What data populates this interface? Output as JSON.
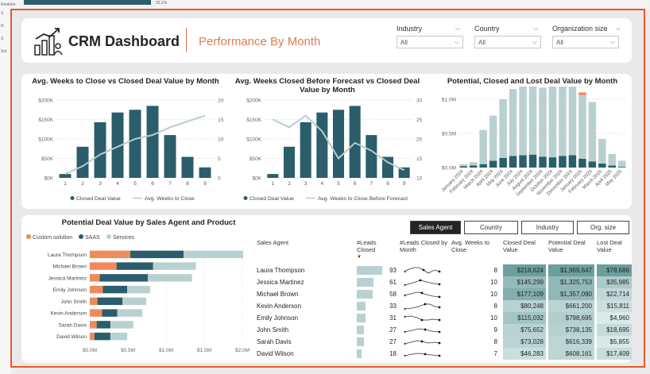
{
  "app": {
    "title": "CRM Dashboard",
    "subtitle": "Performance By Month"
  },
  "background": {
    "left_labels": [
      "Relation",
      "S",
      "N",
      "S",
      "Sot"
    ],
    "top_value": "32.1%"
  },
  "filters": [
    {
      "label": "Industry",
      "value": "All"
    },
    {
      "label": "Country",
      "value": "All"
    },
    {
      "label": "Organization size",
      "value": "All"
    }
  ],
  "colors": {
    "teal": "#2b5e6a",
    "light": "#b8d1d0",
    "orange": "#f08a5d",
    "line": "#b8cccc",
    "accent": "#e8582c"
  },
  "chart1": {
    "title": "Avg. Weeks to Close vs Closed Deal Value by Month",
    "legend": [
      "Closed Deal Value",
      "Avg. Weeks to Close"
    ]
  },
  "chart2": {
    "title_line1": "Avg. Weeks Closed Before Forecast vs Closed Deal",
    "title_line2": "Value by Month",
    "legend": [
      "Closed Deal Value",
      "Avg. Weeks to Close Before Forecast"
    ]
  },
  "chart3": {
    "title": "Potential, Closed and Lost Deal Value by Month"
  },
  "chart4": {
    "title": "Potential Deal Value by Sales Agent and Product",
    "legend": [
      "Custom solution",
      "SAAS",
      "Services"
    ]
  },
  "chart_data": [
    {
      "type": "bar",
      "title": "Avg. Weeks to Close vs Closed Deal Value by Month",
      "categories": [
        "1",
        "2",
        "3",
        "4",
        "5",
        "6",
        "7",
        "8",
        "9"
      ],
      "series": [
        {
          "name": "Closed Deal Value",
          "values": [
            10000,
            80000,
            143000,
            168000,
            175000,
            185000,
            110000,
            54000,
            27000
          ]
        },
        {
          "name": "Avg. Weeks to Close",
          "values": [
            1,
            3,
            6,
            8,
            10,
            11,
            13,
            14.5,
            16
          ]
        }
      ],
      "y_ticks": [
        "$0K",
        "$50K",
        "$100K",
        "$150K",
        "$200K"
      ],
      "y2_ticks": [
        "0",
        "5",
        "10",
        "15",
        "20"
      ],
      "ylim": [
        0,
        200000
      ],
      "y2lim": [
        0,
        20
      ]
    },
    {
      "type": "bar",
      "title": "Avg. Weeks Closed Before Forecast vs Closed Deal Value by Month",
      "categories": [
        "1",
        "2",
        "3",
        "4",
        "5",
        "6",
        "7",
        "8",
        "9"
      ],
      "series": [
        {
          "name": "Closed Deal Value",
          "values": [
            10000,
            80000,
            143000,
            168000,
            175000,
            185000,
            110000,
            54000,
            27000
          ]
        },
        {
          "name": "Avg. Weeks to Close Before Forecast",
          "values": [
            25,
            23,
            26,
            22,
            15,
            19,
            17,
            14,
            12
          ]
        }
      ],
      "y_ticks": [
        "$0K",
        "$50K",
        "$100K",
        "$150K",
        "$200K"
      ],
      "y2_ticks": [
        "10",
        "15",
        "20",
        "25",
        "30"
      ],
      "ylim": [
        0,
        200000
      ],
      "y2lim": [
        10,
        30
      ]
    },
    {
      "type": "bar",
      "title": "Potential, Closed and Lost Deal Value by Month",
      "categories": [
        "January 2024",
        "February 2024",
        "March 2024",
        "April 2024",
        "May 2024",
        "June 2024",
        "July 2024",
        "August 2024",
        "September 2024",
        "October 2024",
        "November 2024",
        "December 2024",
        "January 2025",
        "February 2025",
        "March 2025",
        "April 2025",
        "May 2025"
      ],
      "series": [
        {
          "name": "Closed",
          "values": [
            0.02,
            0.03,
            0.05,
            0.1,
            0.14,
            0.17,
            0.18,
            0.19,
            0.16,
            0.15,
            0.17,
            0.18,
            0.13,
            0.09,
            0.06,
            0.03,
            0.01
          ]
        },
        {
          "name": "Potential",
          "values": [
            0.03,
            0.05,
            0.5,
            0.66,
            0.86,
            0.98,
            1.08,
            1.15,
            1.01,
            1.05,
            1.18,
            1.09,
            0.93,
            0.87,
            0.36,
            0.17,
            0.09
          ]
        },
        {
          "name": "Lost",
          "values": [
            0,
            0,
            0,
            0,
            0,
            0,
            0,
            0.05,
            0,
            0,
            0.05,
            0.02,
            0.04,
            0,
            0,
            0,
            0
          ]
        }
      ],
      "y_ticks": [
        "$0.0M",
        "$0.5M",
        "$1.0M"
      ],
      "ylim": [
        0,
        1.0
      ]
    },
    {
      "type": "bar",
      "title": "Potential Deal Value by Sales Agent and Product",
      "orientation": "horizontal",
      "categories": [
        "Laura Thompson",
        "Michael Brown",
        "Jessica Martinez",
        "Emily Johnson",
        "John Smith",
        "Kevin Anderson",
        "Sarah Davis",
        "David Wilson"
      ],
      "series": [
        {
          "name": "Custom solution",
          "values": [
            0.53,
            0.35,
            0.13,
            0.17,
            0.1,
            0.16,
            0.09,
            0.06
          ]
        },
        {
          "name": "SAAS",
          "values": [
            0.7,
            0.48,
            0.63,
            0.32,
            0.33,
            0.2,
            0.18,
            0.21
          ]
        },
        {
          "name": "Services",
          "values": [
            0.78,
            0.56,
            0.58,
            0.3,
            0.31,
            0.33,
            0.3,
            0.22
          ]
        }
      ],
      "x_ticks": [
        "$0.0M",
        "$0.5M",
        "$1.0M",
        "$1.5M",
        "$2.0M"
      ],
      "xlim": [
        0,
        2.0
      ]
    }
  ],
  "tabs": [
    "Sales Agent",
    "Country",
    "Industry",
    "Org. size"
  ],
  "table": {
    "headers": [
      "Sales Agent",
      "#Leads Closed",
      "#Leads Closed by Month",
      "Avg. Weeks to Close",
      "Closed Deal Value",
      "Potential Deal Value",
      "Lost Deal Value"
    ],
    "rows": [
      {
        "agent": "Laura Thompson",
        "leads": "93",
        "leads_n": 93,
        "weeks": "8",
        "closed": "$218,624",
        "closed_n": 218624,
        "potential": "$1,969,647",
        "potential_n": 1969647,
        "lost": "$78,686",
        "lost_n": 78686
      },
      {
        "agent": "Jessica Martinez",
        "leads": "61",
        "leads_n": 61,
        "weeks": "10",
        "closed": "$145,299",
        "closed_n": 145299,
        "potential": "$1,325,753",
        "potential_n": 1325753,
        "lost": "$35,985",
        "lost_n": 35985
      },
      {
        "agent": "Michael Brown",
        "leads": "58",
        "leads_n": 58,
        "weeks": "10",
        "closed": "$177,109",
        "closed_n": 177109,
        "potential": "$1,357,090",
        "potential_n": 1357090,
        "lost": "$22,714",
        "lost_n": 22714
      },
      {
        "agent": "Kevin Anderson",
        "leads": "33",
        "leads_n": 33,
        "weeks": "8",
        "closed": "$80,248",
        "closed_n": 80248,
        "potential": "$661,200",
        "potential_n": 661200,
        "lost": "$15,811",
        "lost_n": 15811
      },
      {
        "agent": "Emily Johnson",
        "leads": "31",
        "leads_n": 31,
        "weeks": "10",
        "closed": "$115,032",
        "closed_n": 115032,
        "potential": "$798,695",
        "potential_n": 798695,
        "lost": "$4,960",
        "lost_n": 4960
      },
      {
        "agent": "John Smith",
        "leads": "27",
        "leads_n": 27,
        "weeks": "9",
        "closed": "$75,652",
        "closed_n": 75652,
        "potential": "$738,135",
        "potential_n": 738135,
        "lost": "$18,695",
        "lost_n": 18695
      },
      {
        "agent": "Sarah Davis",
        "leads": "27",
        "leads_n": 27,
        "weeks": "8",
        "closed": "$73,028",
        "closed_n": 73028,
        "potential": "$616,339",
        "potential_n": 616339,
        "lost": "$5,855",
        "lost_n": 5855
      },
      {
        "agent": "David Wilson",
        "leads": "18",
        "leads_n": 18,
        "weeks": "7",
        "closed": "$46,283",
        "closed_n": 46283,
        "potential": "$608,161",
        "potential_n": 608161,
        "lost": "$17,409",
        "lost_n": 17409
      }
    ]
  }
}
